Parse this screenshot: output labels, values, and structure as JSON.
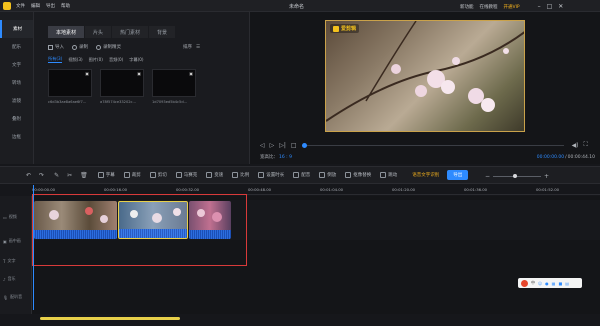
{
  "app": {
    "title": "未命名",
    "menu": [
      "文件",
      "编辑",
      "导出",
      "帮助"
    ],
    "right_menu": [
      "新功能",
      "在线教程",
      "开通VIP"
    ]
  },
  "rail": {
    "items": [
      {
        "label": "素材",
        "active": true
      },
      {
        "label": "配乐",
        "active": false
      },
      {
        "label": "文字",
        "active": false
      },
      {
        "label": "转场",
        "active": false
      },
      {
        "label": "滤镜",
        "active": false
      },
      {
        "label": "叠附",
        "active": false
      },
      {
        "label": "边框",
        "active": false
      }
    ]
  },
  "media": {
    "tabs": [
      "本地素材",
      "片头",
      "热门素材",
      "背景"
    ],
    "import_label": "导入",
    "record_label": "录制",
    "record_screen_label": "录制精灵",
    "sort_label": "排序",
    "filters": [
      "所有(3)",
      "视频(3)",
      "图片(0)",
      "音频(0)",
      "字幕(0)"
    ],
    "files": [
      {
        "name": "c6d3b3ae8a6ae6f7..."
      },
      {
        "name": "a78f574ce33202c..."
      },
      {
        "name": "1d7093ed5b4c5d..."
      }
    ]
  },
  "preview": {
    "watermark": "爱剪辑",
    "ratio_label": "宽高比：",
    "ratio_value": "16 : 9",
    "current_time": "00:00:00.00",
    "total_time": "00:00:44.10"
  },
  "toolbar": {
    "items": [
      "字幕",
      "裁剪",
      "剪切",
      "马赛克",
      "变速",
      "比例",
      "设置时长",
      "配音",
      "倒放",
      "抠像替换",
      "跳动"
    ],
    "ai_label": "语音文字识别",
    "export_label": "导出",
    "zoom": "1x"
  },
  "ruler": {
    "ticks": [
      "00:00:00.00",
      "00:00:16.00",
      "00:00:32.00",
      "00:00:48.00",
      "00:01:04.00",
      "00:01:20.00",
      "00:01:36.00",
      "00:01:52.00"
    ]
  },
  "tracks": [
    {
      "label": "视频"
    },
    {
      "label": "画中画"
    },
    {
      "label": "文字"
    },
    {
      "label": "音乐"
    },
    {
      "label": "配叭音"
    }
  ],
  "colors": {
    "accent": "#2e8bff",
    "selection": "#d83a3a",
    "logo": "#f4c21d",
    "vip": "#f5b21d"
  }
}
